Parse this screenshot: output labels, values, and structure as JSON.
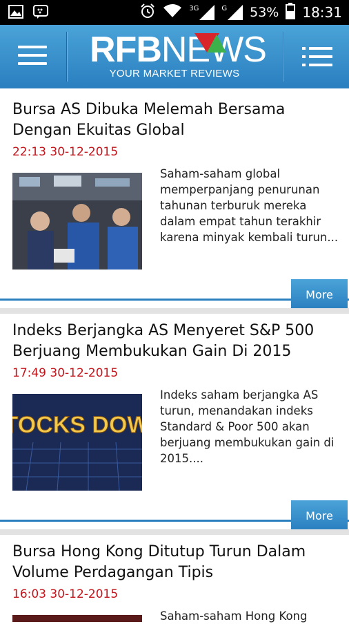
{
  "status_bar": {
    "signal_1": "3G",
    "signal_2": "G",
    "battery": "53%",
    "time": "18:31",
    "icons": [
      "gallery-icon",
      "bbm-icon",
      "alarm-icon",
      "wifi-icon",
      "signal-icon",
      "battery-icon"
    ]
  },
  "app_bar": {
    "logo_bold": "RFB",
    "logo_light": "NEWS",
    "tagline": "YOUR MARKET REVIEWS",
    "colors": {
      "bar": "#2a7fbf",
      "logo_red": "#d9252a",
      "logo_green": "#3db24a"
    }
  },
  "articles": [
    {
      "title": "Bursa AS Dibuka Melemah Bersama Dengan Ekuitas Global",
      "time": "22:13 30-12-2015",
      "summary": "Saham-saham global memperpanjang penurunan tahunan terburuk mereka dalam empat tahun terakhir karena minyak kembali turun...",
      "more": "More"
    },
    {
      "title": "Indeks Berjangka AS Menyeret S&P 500 Berjuang Membukukan Gain Di 2015",
      "time": "17:49 30-12-2015",
      "summary": "Indeks saham berjangka AS turun, menandakan indeks Standard & Poor 500 akan berjuang membukukan gain di 2015....",
      "more": "More",
      "image_text": "STOCKS DOWN"
    },
    {
      "title": "Bursa Hong Kong Ditutup Turun Dalam Volume Perdagangan Tipis",
      "time": "16:03 30-12-2015",
      "summary": "Saham-saham Hong Kong"
    }
  ]
}
